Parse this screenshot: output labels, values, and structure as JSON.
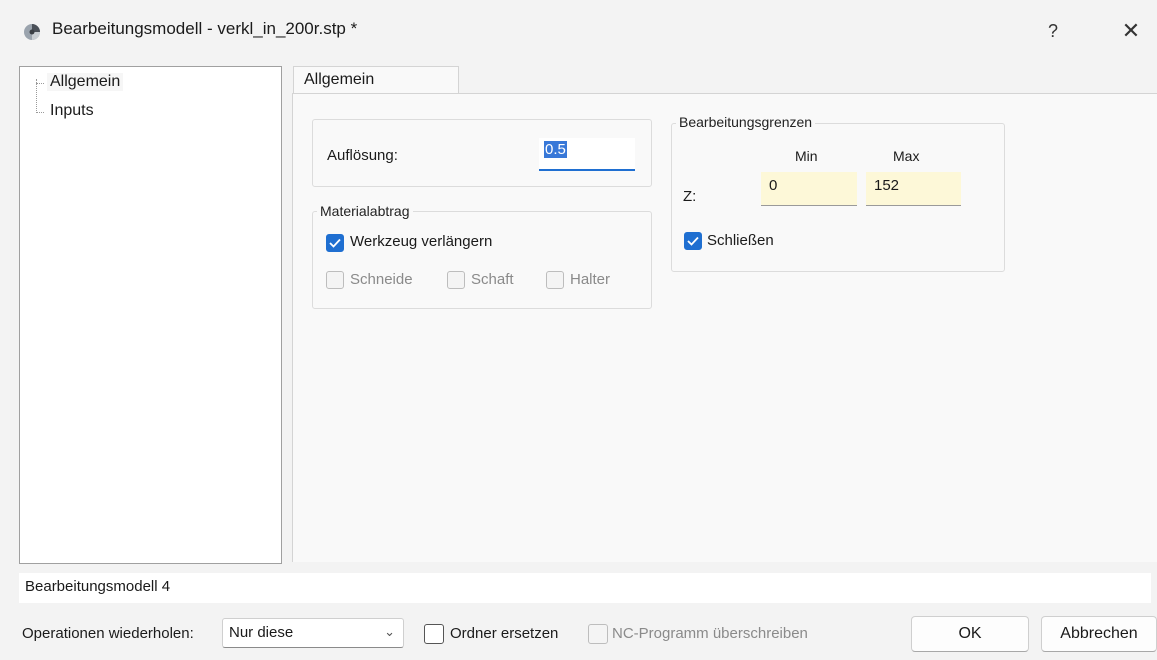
{
  "window": {
    "title": "Bearbeitungsmodell - verkl_in_200r.stp *",
    "help_label": "?",
    "close_label": "✕"
  },
  "tree": {
    "items": [
      {
        "label": "Allgemein",
        "selected": true
      },
      {
        "label": "Inputs",
        "selected": false
      }
    ]
  },
  "tabs": [
    {
      "label": "Allgemein",
      "active": true
    }
  ],
  "general": {
    "resolution_label": "Auflösung:",
    "resolution_value": "0.5"
  },
  "material": {
    "legend": "Materialabtrag",
    "extend_tool_label": "Werkzeug verlängern",
    "extend_tool_checked": true,
    "cutting_label": "Schneide",
    "cutting_checked": false,
    "shaft_label": "Schaft",
    "shaft_checked": false,
    "holder_label": "Halter",
    "holder_checked": false
  },
  "limits": {
    "legend": "Bearbeitungsgrenzen",
    "min_header": "Min",
    "max_header": "Max",
    "z_label": "Z:",
    "z_min": "0",
    "z_max": "152",
    "close_label": "Schließen",
    "close_checked": true
  },
  "status": {
    "text": "Bearbeitungsmodell 4"
  },
  "footer": {
    "repeat_label": "Operationen wiederholen:",
    "repeat_value": "Nur diese",
    "replace_folder_label": "Ordner ersetzen",
    "replace_folder_checked": false,
    "overwrite_nc_label": "NC-Programm überschreiben",
    "overwrite_nc_checked": false,
    "ok_label": "OK",
    "cancel_label": "Abbrechen"
  },
  "colors": {
    "accent": "#1f6fd1",
    "field_highlight": "#fdf8d8",
    "selection": "#3878d8"
  }
}
